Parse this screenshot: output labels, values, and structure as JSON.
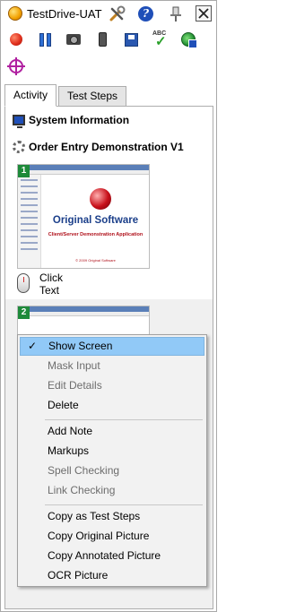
{
  "window": {
    "title": "TestDrive-UAT",
    "close_glyph": "✕",
    "help_glyph": "?"
  },
  "toolbar": {
    "icons": [
      "record-icon",
      "pause-icon",
      "camera-icon",
      "phone-icon",
      "save-icon",
      "spell-check-icon",
      "globe-icon",
      "target-icon"
    ],
    "spell_text": "ABC",
    "spell_check": "✓"
  },
  "tabs": [
    {
      "label": "Activity",
      "active": true
    },
    {
      "label": "Test Steps",
      "active": false
    }
  ],
  "activity": {
    "system_info": "System Information",
    "order_entry": "Order Entry Demonstration V1",
    "step1": {
      "number": "1",
      "brand": "Original Software",
      "subtitle": "Client/Server Demonstration Application",
      "copyright": "© 2009 Original Software"
    },
    "action": {
      "line1": "Click",
      "line2": "Text"
    },
    "step2": {
      "number": "2"
    }
  },
  "context_menu": {
    "check_glyph": "✓",
    "items": [
      {
        "label": "Show Screen",
        "checked": true,
        "highlighted": true,
        "disabled": false
      },
      {
        "label": "Mask Input",
        "disabled": true
      },
      {
        "label": "Edit Details",
        "disabled": true
      },
      {
        "label": "Delete",
        "disabled": false
      },
      {
        "label": "Add Note",
        "disabled": false
      },
      {
        "label": "Markups",
        "disabled": false
      },
      {
        "label": "Spell Checking",
        "disabled": true
      },
      {
        "label": "Link Checking",
        "disabled": true
      },
      {
        "label": "Copy as Test Steps",
        "disabled": false
      },
      {
        "label": "Copy Original Picture",
        "disabled": false
      },
      {
        "label": "Copy Annotated Picture",
        "disabled": false
      },
      {
        "label": "OCR Picture",
        "disabled": false
      }
    ]
  },
  "colors": {
    "highlight": "#91c9f7",
    "step_badge": "#1e8a3a",
    "brand_blue": "#1b3f8a",
    "brand_red": "#b0101a"
  }
}
